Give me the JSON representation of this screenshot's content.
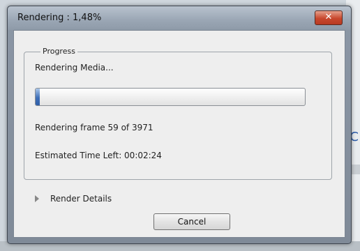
{
  "window": {
    "title": "Rendering : 1,48%",
    "close_label": "✕"
  },
  "progress": {
    "group_label": "Progress",
    "status": "Rendering Media...",
    "fraction": 0.0148,
    "frame_text": "Rendering frame 59 of 3971",
    "time_left": "Estimated Time Left: 00:02:24"
  },
  "details": {
    "label": "Render Details"
  },
  "buttons": {
    "cancel": "Cancel"
  },
  "background": {
    "partial_glyph": "C"
  },
  "colors": {
    "progress_fill": "#3f6fb8",
    "close_button": "#c8482e"
  }
}
